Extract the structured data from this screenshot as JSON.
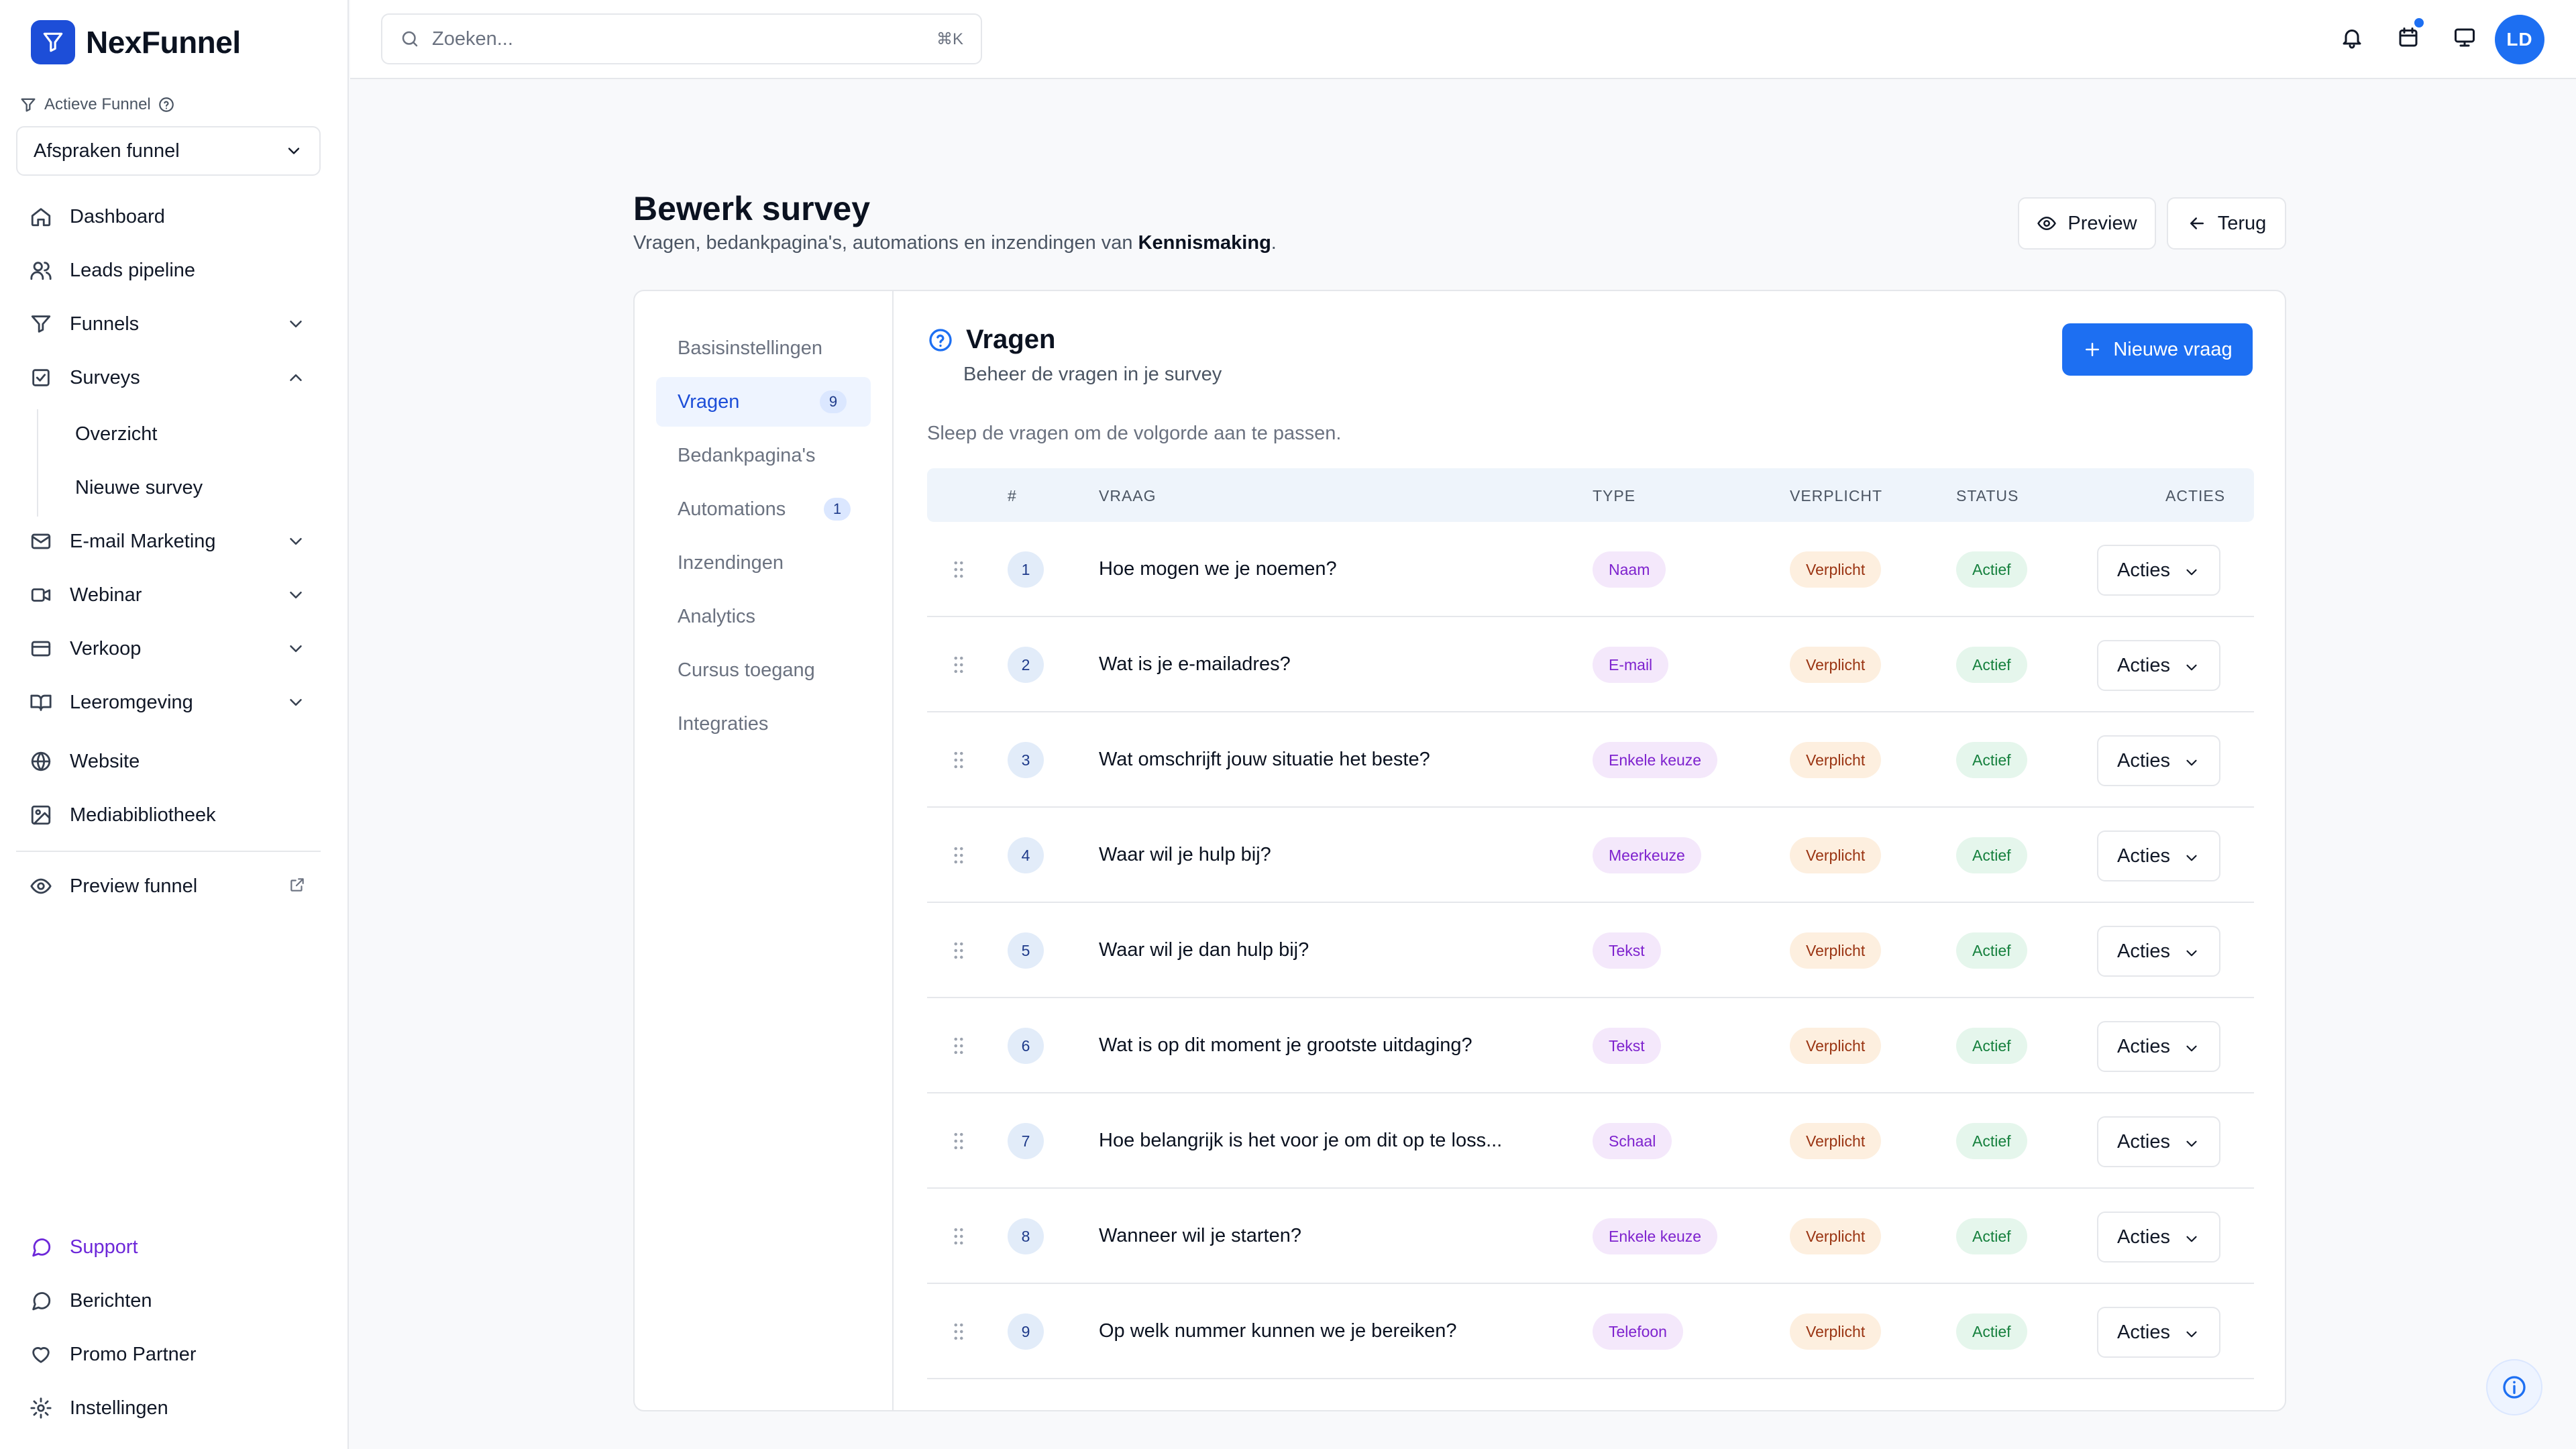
{
  "app": {
    "name": "NexFunnel"
  },
  "funnel": {
    "label": "Actieve Funnel",
    "selected": "Afspraken funnel"
  },
  "nav": {
    "dashboard": "Dashboard",
    "leads": "Leads pipeline",
    "funnels": "Funnels",
    "surveys": "Surveys",
    "surveys_sub": [
      "Overzicht",
      "Nieuwe survey"
    ],
    "email": "E-mail Marketing",
    "webinar": "Webinar",
    "verkoop": "Verkoop",
    "leeromgeving": "Leeromgeving",
    "website": "Website",
    "media": "Mediabibliotheek",
    "preview": "Preview funnel",
    "support": "Support",
    "berichten": "Berichten",
    "promo": "Promo Partner",
    "instellingen": "Instellingen"
  },
  "search": {
    "placeholder": "Zoeken...",
    "shortcut": "⌘K"
  },
  "user": {
    "initials": "LD"
  },
  "page": {
    "title": "Bewerk survey",
    "subtitle_prefix": "Vragen, bedankpagina's, automations en inzendingen van ",
    "subtitle_name": "Kennismaking",
    "subtitle_suffix": ".",
    "preview_label": "Preview",
    "back_label": "Terug"
  },
  "tabs": [
    {
      "label": "Basisinstellingen"
    },
    {
      "label": "Vragen",
      "count": "9"
    },
    {
      "label": "Bedankpagina's"
    },
    {
      "label": "Automations",
      "count": "1"
    },
    {
      "label": "Inzendingen"
    },
    {
      "label": "Analytics"
    },
    {
      "label": "Cursus toegang"
    },
    {
      "label": "Integraties"
    }
  ],
  "section": {
    "title": "Vragen",
    "subtitle": "Beheer de vragen in je survey",
    "new_button": "Nieuwe vraag",
    "hint": "Sleep de vragen om de volgorde aan te passen."
  },
  "table": {
    "headers": {
      "num": "#",
      "vraag": "VRAAG",
      "type": "TYPE",
      "verplicht": "VERPLICHT",
      "status": "STATUS",
      "acties": "ACTIES"
    },
    "action_label": "Acties",
    "rows": [
      {
        "n": "1",
        "question": "Hoe mogen we je noemen?",
        "type": "Naam",
        "required": "Verplicht",
        "status": "Actief"
      },
      {
        "n": "2",
        "question": "Wat is je e-mailadres?",
        "type": "E-mail",
        "required": "Verplicht",
        "status": "Actief"
      },
      {
        "n": "3",
        "question": "Wat omschrijft jouw situatie het beste?",
        "type": "Enkele keuze",
        "required": "Verplicht",
        "status": "Actief"
      },
      {
        "n": "4",
        "question": "Waar wil je hulp bij?",
        "type": "Meerkeuze",
        "required": "Verplicht",
        "status": "Actief"
      },
      {
        "n": "5",
        "question": "Waar wil je dan hulp bij?",
        "type": "Tekst",
        "required": "Verplicht",
        "status": "Actief"
      },
      {
        "n": "6",
        "question": "Wat is op dit moment je grootste uitdaging?",
        "type": "Tekst",
        "required": "Verplicht",
        "status": "Actief"
      },
      {
        "n": "7",
        "question": "Hoe belangrijk is het voor je om dit op te loss...",
        "type": "Schaal",
        "required": "Verplicht",
        "status": "Actief"
      },
      {
        "n": "8",
        "question": "Wanneer wil je starten?",
        "type": "Enkele keuze",
        "required": "Verplicht",
        "status": "Actief"
      },
      {
        "n": "9",
        "question": "Op welk nummer kunnen we je bereiken?",
        "type": "Telefoon",
        "required": "Verplicht",
        "status": "Actief"
      }
    ]
  },
  "colors": {
    "primary": "#1d6ff2",
    "brand": "#1d4ed8",
    "support": "#6d28d9"
  }
}
